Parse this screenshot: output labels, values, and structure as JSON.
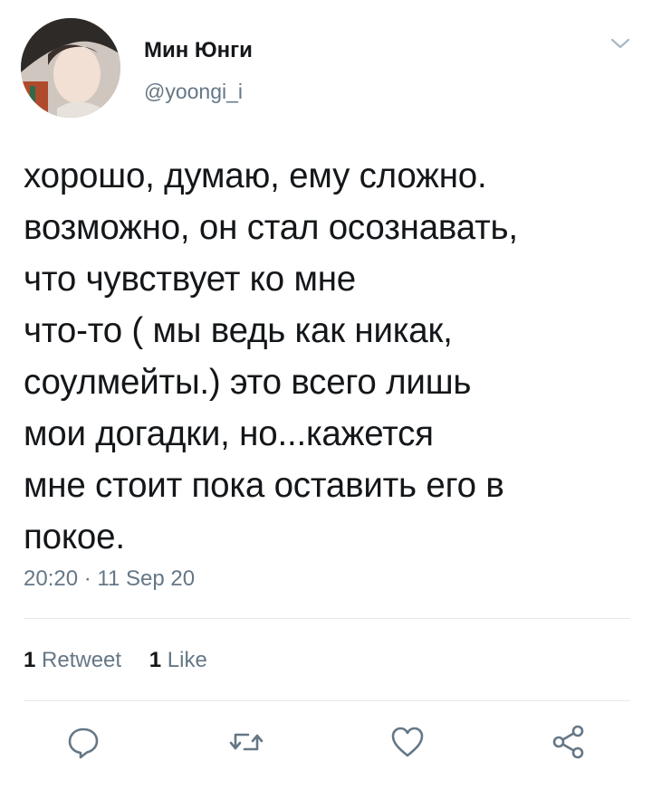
{
  "user": {
    "display_name": "Мин Юнги",
    "handle": "@yoongi_i"
  },
  "tweet": {
    "lines": [
      "хорошо, думаю, ему сложно.",
      "возможно, он стал осознавать,",
      "что чувствует ко мне",
      "что-то ( мы ведь как никак,",
      "соулмейты.) это всего лишь",
      "мои догадки, но...кажется",
      "мне стоит пока оставить его в",
      "покое."
    ],
    "timestamp": "20:20 · 11 Sep 20"
  },
  "stats": {
    "retweets_count": "1",
    "retweets_label": "Retweet",
    "likes_count": "1",
    "likes_label": "Like"
  },
  "actions": [
    "reply-icon",
    "retweet-icon",
    "like-icon",
    "share-icon"
  ],
  "colors": {
    "text": "#14171a",
    "secondary": "#657786",
    "divider": "#e1e8ed",
    "icon": "#657786"
  }
}
